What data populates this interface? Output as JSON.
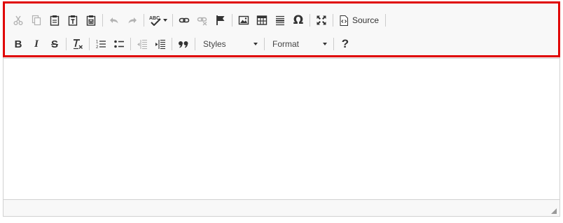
{
  "toolbar": {
    "source_label": "Source",
    "styles_label": "Styles",
    "format_label": "Format",
    "spell_label": "ABC",
    "bold_glyph": "B",
    "italic_glyph": "I",
    "strike_glyph": "S",
    "blockquote_glyph": "❞",
    "omega_glyph": "Ω",
    "help_glyph": "?"
  },
  "colors": {
    "highlight": "#e00000",
    "toolbar_bg": "#f8f8f8",
    "border": "#d1d1d1",
    "icon": "#333333"
  }
}
